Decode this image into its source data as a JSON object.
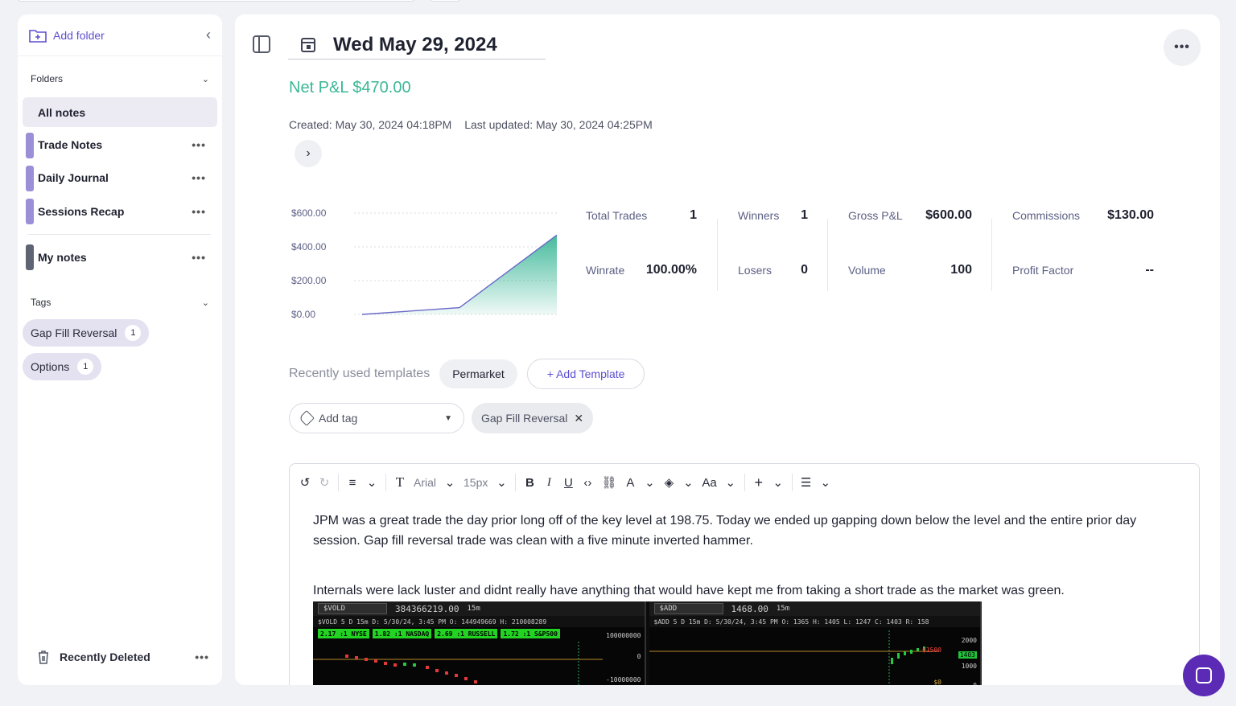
{
  "sidebar": {
    "add_folder": "Add folder",
    "folders_heading": "Folders",
    "folders": [
      {
        "label": "All notes",
        "active": true
      },
      {
        "label": "Trade Notes"
      },
      {
        "label": "Daily Journal"
      },
      {
        "label": "Sessions Recap"
      }
    ],
    "my_notes": "My notes",
    "tags_heading": "Tags",
    "tags": [
      {
        "label": "Gap Fill Reversal",
        "count": "1"
      },
      {
        "label": "Options",
        "count": "1"
      }
    ],
    "recently_deleted": "Recently Deleted"
  },
  "note": {
    "date": "Wed May 29, 2024",
    "net_pl": "Net P&L $470.00",
    "created": "Created: May 30, 2024 04:18PM",
    "updated": "Last updated: May 30, 2024 04:25PM"
  },
  "stats": {
    "total_trades_label": "Total Trades",
    "total_trades": "1",
    "winrate_label": "Winrate",
    "winrate": "100.00%",
    "winners_label": "Winners",
    "winners": "1",
    "losers_label": "Losers",
    "losers": "0",
    "gross_pl_label": "Gross P&L",
    "gross_pl": "$600.00",
    "volume_label": "Volume",
    "volume": "100",
    "commissions_label": "Commissions",
    "commissions": "$130.00",
    "profit_factor_label": "Profit Factor",
    "profit_factor": "--"
  },
  "chart_data": {
    "type": "area",
    "y_ticks": [
      "$600.00",
      "$400.00",
      "$200.00",
      "$0.00"
    ],
    "ylim": [
      0,
      600
    ],
    "values": [
      0,
      40,
      470
    ],
    "fill_color": "#3bb797",
    "line_color": "#6b68c9"
  },
  "templates": {
    "label": "Recently used templates",
    "items": [
      "Permarket"
    ],
    "add_label": "+ Add Template"
  },
  "tagging": {
    "add_tag_placeholder": "Add tag",
    "applied": [
      "Gap Fill Reversal"
    ]
  },
  "editor": {
    "font": "Arial",
    "size": "15px",
    "case_btn": "Aa",
    "paragraphs": [
      "JPM was a great trade the day prior long off of the key level at 198.75. Today we ended up gapping down below the level and the entire prior day session. Gap fill reversal trade was clean with a five minute inverted hammer.",
      "Internals were  lack luster and didnt really have anything that would have kept me from taking a short trade as the market was green."
    ]
  },
  "screenshot": {
    "left": {
      "symbol": "$VOLD",
      "price": "384366219.00",
      "interval": "15m",
      "info": "$VOLD 5 D 15m  D: 5/30/24, 3:45 PM  O: 144949669  H: 210008289",
      "ratios": [
        "2.17 :1 NYSE",
        "1.82 :1 NASDAQ",
        "2.69 :1 RUSSELL",
        "1.72 :1 S&P500"
      ],
      "axis": [
        "100000000",
        "0",
        "-10000000"
      ]
    },
    "right": {
      "symbol": "$ADD",
      "price": "1468.00",
      "interval": "15m",
      "info": "$ADD 5 D 15m  D: 5/30/24, 3:45 PM  O: 1365  H: 1405  L: 1247  C: 1403  R: 158",
      "axis": [
        "2000",
        "1403",
        "1000",
        "0"
      ],
      "markers": [
        "$1500",
        "$0"
      ]
    }
  }
}
